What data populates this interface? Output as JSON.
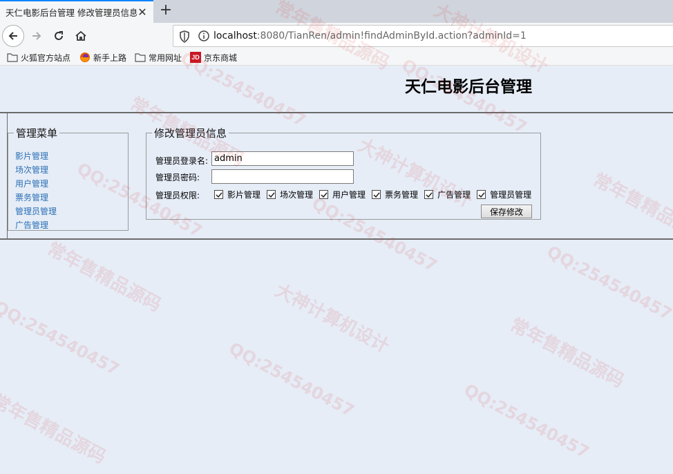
{
  "browser": {
    "tab_title": "天仁电影后台管理 修改管理员信息",
    "url_host": "localhost",
    "url_rest": ":8080/TianRen/admin!findAdminById.action?adminId=1",
    "bookmarks": [
      "火狐官方站点",
      "新手上路",
      "常用网址",
      "京东商城"
    ],
    "jd_logo": "JD"
  },
  "header": {
    "title": "天仁电影后台管理"
  },
  "menu": {
    "legend": "管理菜单",
    "items": [
      "影片管理",
      "场次管理",
      "用户管理",
      "票务管理",
      "管理员管理",
      "广告管理"
    ]
  },
  "form": {
    "legend": "修改管理员信息",
    "username_label": "管理员登录名:",
    "username_value": "admin",
    "password_label": "管理员密码:",
    "password_value": "",
    "permission_label": "管理员权限:",
    "permissions": [
      {
        "label": "影片管理",
        "checked": true
      },
      {
        "label": "场次管理",
        "checked": true
      },
      {
        "label": "用户管理",
        "checked": true
      },
      {
        "label": "票务管理",
        "checked": true
      },
      {
        "label": "广告管理",
        "checked": true
      },
      {
        "label": "管理员管理",
        "checked": true
      }
    ],
    "save_label": "保存修改"
  },
  "watermarks": [
    "常年售精品源码",
    "大神计算机设计",
    "QQ:254540457"
  ]
}
